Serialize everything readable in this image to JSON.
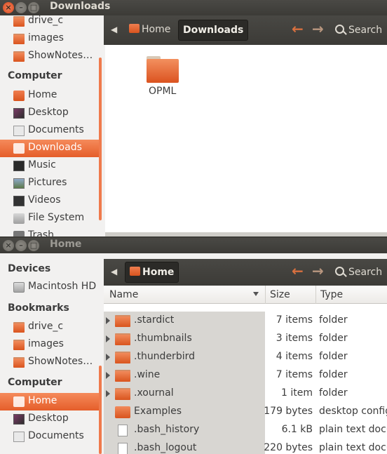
{
  "top_window": {
    "title": "Downloads",
    "sidebar": {
      "items_above": [
        {
          "label": "drive_c",
          "icon": "folder-icon"
        },
        {
          "label": "images",
          "icon": "folder-icon"
        },
        {
          "label": "ShowNotes…",
          "icon": "folder-icon"
        }
      ],
      "computer_heading": "Computer",
      "computer_items": [
        {
          "label": "Home",
          "icon": "home-icon",
          "selected": false
        },
        {
          "label": "Desktop",
          "icon": "desktop-icon",
          "selected": false
        },
        {
          "label": "Documents",
          "icon": "documents-icon",
          "selected": false
        },
        {
          "label": "Downloads",
          "icon": "downloads-icon",
          "selected": true
        },
        {
          "label": "Music",
          "icon": "music-icon",
          "selected": false
        },
        {
          "label": "Pictures",
          "icon": "pictures-icon",
          "selected": false
        },
        {
          "label": "Videos",
          "icon": "videos-icon",
          "selected": false
        },
        {
          "label": "File System",
          "icon": "filesystem-icon",
          "selected": false
        },
        {
          "label": "Trash",
          "icon": "trash-icon",
          "selected": false
        }
      ]
    },
    "breadcrumb": {
      "home": "Home",
      "current": "Downloads"
    },
    "search_label": "Search",
    "files": [
      {
        "name": "OPML",
        "icon": "folder-icon"
      }
    ]
  },
  "bottom_window": {
    "title": "Home",
    "sidebar": {
      "devices_heading": "Devices",
      "devices": [
        {
          "label": "Macintosh HD",
          "icon": "drive-icon"
        }
      ],
      "bookmarks_heading": "Bookmarks",
      "bookmarks": [
        {
          "label": "drive_c",
          "icon": "folder-icon"
        },
        {
          "label": "images",
          "icon": "folder-icon"
        },
        {
          "label": "ShowNotes…",
          "icon": "folder-icon"
        }
      ],
      "computer_heading": "Computer",
      "computer_items": [
        {
          "label": "Home",
          "icon": "home-icon",
          "selected": true
        },
        {
          "label": "Desktop",
          "icon": "desktop-icon",
          "selected": false
        },
        {
          "label": "Documents",
          "icon": "documents-icon",
          "selected": false
        }
      ]
    },
    "breadcrumb": {
      "current": "Home"
    },
    "search_label": "Search",
    "columns": {
      "name": "Name",
      "size": "Size",
      "type": "Type"
    },
    "rows": [
      {
        "name": ".stardict",
        "size": "7 items",
        "type": "folder",
        "expandable": true,
        "icon": "folder-icon"
      },
      {
        "name": ".thumbnails",
        "size": "3 items",
        "type": "folder",
        "expandable": true,
        "icon": "folder-icon"
      },
      {
        "name": ".thunderbird",
        "size": "4 items",
        "type": "folder",
        "expandable": true,
        "icon": "folder-icon"
      },
      {
        "name": ".wine",
        "size": "7 items",
        "type": "folder",
        "expandable": true,
        "icon": "folder-icon"
      },
      {
        "name": ".xournal",
        "size": "1 item",
        "type": "folder",
        "expandable": true,
        "icon": "folder-icon"
      },
      {
        "name": "Examples",
        "size": "179 bytes",
        "type": "desktop config",
        "expandable": false,
        "icon": "link-icon"
      },
      {
        "name": ".bash_history",
        "size": "6.1 kB",
        "type": "plain text docu",
        "expandable": false,
        "icon": "text-file-icon"
      },
      {
        "name": ".bash_logout",
        "size": "220 bytes",
        "type": "plain text docu",
        "expandable": false,
        "icon": "text-file-icon"
      }
    ]
  },
  "colors": {
    "accent": "#e95420",
    "titlebar": "#3c3b37",
    "sidebar_bg": "#f2f1f0"
  }
}
